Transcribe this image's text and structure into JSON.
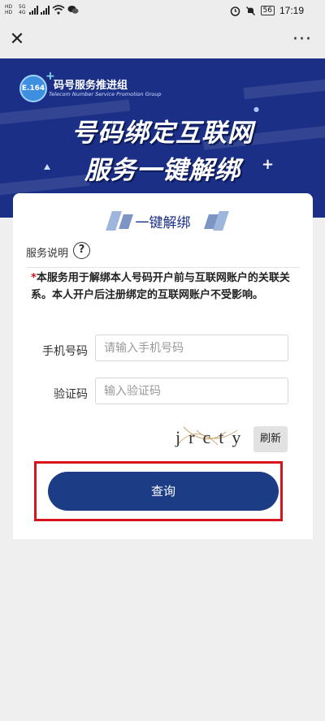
{
  "status_bar": {
    "time": "17:19",
    "battery": "56",
    "network_badge_1": "HD",
    "network_badge_2": "HD",
    "signal_label_1": "5G",
    "signal_label_2": "4G"
  },
  "nav": {
    "close_icon": "close-icon",
    "more_icon": "more-icon"
  },
  "banner": {
    "org_logo_text": "E.164",
    "org_name": "码号服务推进组",
    "org_name_en": "Telecom Number Service Promotion Group",
    "headline_line1": "号码绑定互联网",
    "headline_line2": "服务一键解绑"
  },
  "card": {
    "title": "一键解绑",
    "service_label": "服务说明",
    "help_glyph": "?",
    "notice_star": "*",
    "notice_text": "本服务用于解绑本人号码开户前与互联网账户的关联关系。本人开户后注册绑定的互联网账户不受影响。",
    "phone_label": "手机号码",
    "phone_placeholder": "请输入手机号码",
    "phone_value": "",
    "code_label": "验证码",
    "code_placeholder": "输入验证码",
    "code_value": "",
    "captcha_text": "jrcty",
    "refresh_label": "刷新",
    "query_label": "查询"
  },
  "colors": {
    "banner_bg": "#1b2f86",
    "primary_button": "#1c3c86",
    "highlight_border": "#d7141d",
    "page_bg": "#efefef"
  }
}
